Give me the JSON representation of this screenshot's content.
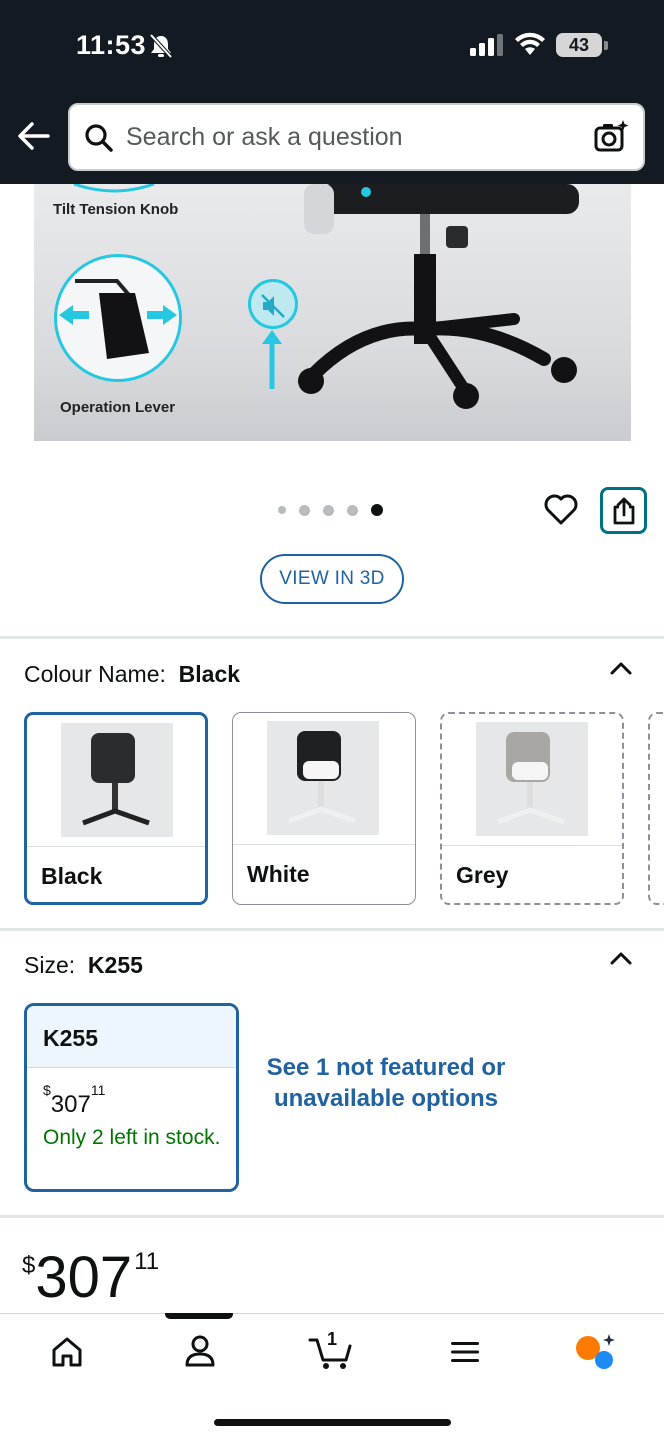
{
  "status_bar": {
    "time": "11:53",
    "battery": "43"
  },
  "header": {
    "search_placeholder": "Search or ask a question"
  },
  "product_image": {
    "callout_1": "Tilt Tension Knob",
    "callout_2": "Operation Lever",
    "dots_total": 5,
    "active_dot": 5
  },
  "actions": {
    "view_3d": "VIEW IN 3D"
  },
  "colour": {
    "label": "Colour Name:",
    "selected": "Black",
    "options": [
      {
        "name": "Black",
        "state": "selected"
      },
      {
        "name": "White",
        "state": "available"
      },
      {
        "name": "Grey",
        "state": "unavailable"
      }
    ]
  },
  "size": {
    "label": "Size:",
    "selected": "K255",
    "card": {
      "name": "K255",
      "price_currency": "$",
      "price_whole": "307",
      "price_cents": "11",
      "stock": "Only 2 left in stock."
    },
    "more_options": "See 1 not featured or unavailable options"
  },
  "price": {
    "currency": "$",
    "whole": "307",
    "cents": "11"
  },
  "bottom_nav": {
    "cart_count": "1",
    "items": [
      "home-icon",
      "account-icon",
      "cart-icon",
      "menu-icon",
      "rufus-icon"
    ]
  },
  "colors": {
    "header_bg": "#131a22",
    "link_blue": "#2162a1",
    "teal": "#007185",
    "stock_green": "#007600"
  }
}
